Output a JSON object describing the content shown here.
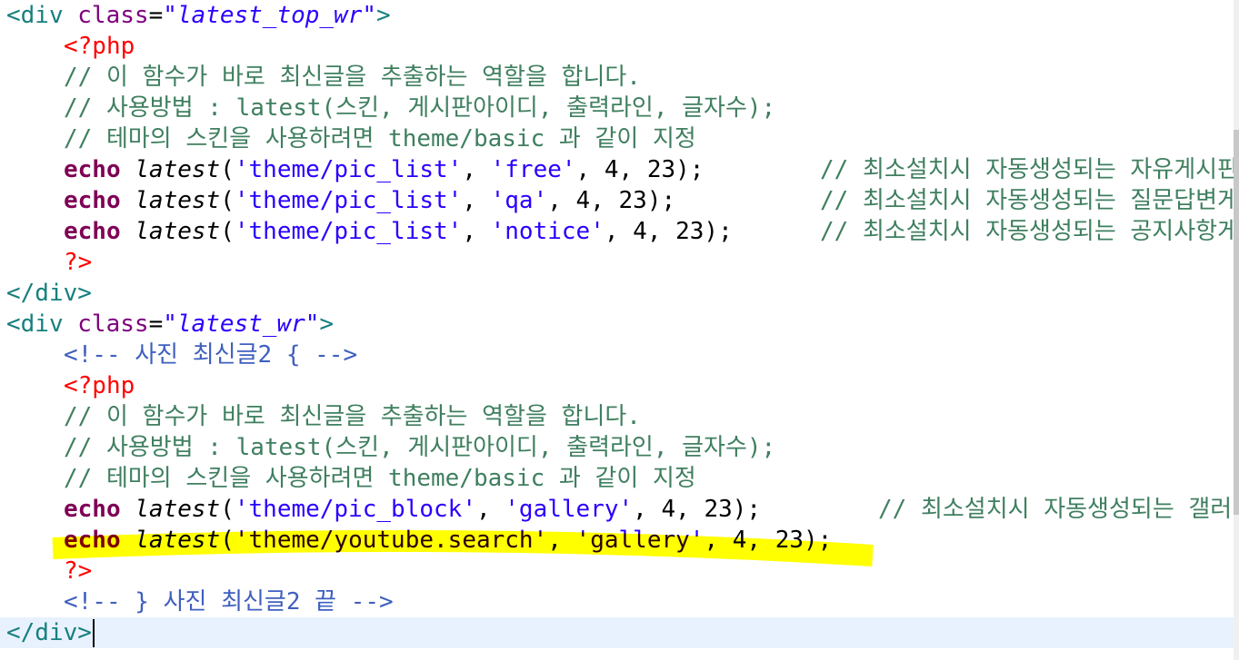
{
  "colors": {
    "highlight": "#ffff00",
    "current_line": "#e8f2fe"
  },
  "lines": [
    {
      "indent": 0,
      "tokens": [
        {
          "k": "tag",
          "t": "<div "
        },
        {
          "k": "attr",
          "t": "class"
        },
        {
          "k": "eq",
          "t": "="
        },
        {
          "k": "val",
          "t": "\"latest_top_wr\""
        },
        {
          "k": "tag",
          "t": ">"
        }
      ]
    },
    {
      "indent": 1,
      "tokens": [
        {
          "k": "php",
          "t": "<?php"
        }
      ]
    },
    {
      "indent": 1,
      "tokens": [
        {
          "k": "cmt",
          "t": "// 이 함수가 바로 최신글을 추출하는 역할을 합니다."
        }
      ]
    },
    {
      "indent": 1,
      "tokens": [
        {
          "k": "cmt",
          "t": "// 사용방법 : latest(스킨, 게시판아이디, 출력라인, 글자수);"
        }
      ]
    },
    {
      "indent": 1,
      "tokens": [
        {
          "k": "cmt",
          "t": "// 테마의 스킨을 사용하려면 theme/basic 과 같이 지정"
        }
      ]
    },
    {
      "indent": 1,
      "tokens": [
        {
          "k": "kw",
          "t": "echo"
        },
        {
          "k": "pun",
          "t": " "
        },
        {
          "k": "fn",
          "t": "latest"
        },
        {
          "k": "pun",
          "t": "("
        },
        {
          "k": "str",
          "t": "'theme/pic_list'"
        },
        {
          "k": "pun",
          "t": ", "
        },
        {
          "k": "str",
          "t": "'free'"
        },
        {
          "k": "pun",
          "t": ", 4, 23);"
        }
      ],
      "tail": {
        "col": "c902",
        "t": "// 최소설치시 자동생성되는 자유게시판"
      }
    },
    {
      "indent": 1,
      "tokens": [
        {
          "k": "kw",
          "t": "echo"
        },
        {
          "k": "pun",
          "t": " "
        },
        {
          "k": "fn",
          "t": "latest"
        },
        {
          "k": "pun",
          "t": "("
        },
        {
          "k": "str",
          "t": "'theme/pic_list'"
        },
        {
          "k": "pun",
          "t": ", "
        },
        {
          "k": "str",
          "t": "'qa'"
        },
        {
          "k": "pun",
          "t": ", 4, 23);"
        }
      ],
      "tail": {
        "col": "c902",
        "t": "// 최소설치시 자동생성되는 질문답변게시"
      }
    },
    {
      "indent": 1,
      "tokens": [
        {
          "k": "kw",
          "t": "echo"
        },
        {
          "k": "pun",
          "t": " "
        },
        {
          "k": "fn",
          "t": "latest"
        },
        {
          "k": "pun",
          "t": "("
        },
        {
          "k": "str",
          "t": "'theme/pic_list'"
        },
        {
          "k": "pun",
          "t": ", "
        },
        {
          "k": "str",
          "t": "'notice'"
        },
        {
          "k": "pun",
          "t": ", 4, 23);"
        }
      ],
      "tail": {
        "col": "c902",
        "t": "// 최소설치시 자동생성되는 공지사항게시"
      }
    },
    {
      "indent": 1,
      "tokens": [
        {
          "k": "php",
          "t": "?>"
        }
      ]
    },
    {
      "indent": 0,
      "tokens": [
        {
          "k": "tag",
          "t": "</div>"
        }
      ]
    },
    {
      "indent": 0,
      "tokens": [
        {
          "k": "tag",
          "t": "<div "
        },
        {
          "k": "attr",
          "t": "class"
        },
        {
          "k": "eq",
          "t": "="
        },
        {
          "k": "val",
          "t": "\"latest_wr\""
        },
        {
          "k": "tag",
          "t": ">"
        }
      ]
    },
    {
      "indent": 1,
      "tokens": [
        {
          "k": "html-cmt",
          "t": "<!-- 사진 최신글2 { -->"
        }
      ]
    },
    {
      "indent": 1,
      "tokens": [
        {
          "k": "php",
          "t": "<?php"
        }
      ]
    },
    {
      "indent": 1,
      "tokens": [
        {
          "k": "cmt",
          "t": "// 이 함수가 바로 최신글을 추출하는 역할을 합니다."
        }
      ]
    },
    {
      "indent": 1,
      "tokens": [
        {
          "k": "cmt",
          "t": "// 사용방법 : latest(스킨, 게시판아이디, 출력라인, 글자수);"
        }
      ]
    },
    {
      "indent": 1,
      "tokens": [
        {
          "k": "cmt",
          "t": "// 테마의 스킨을 사용하려면 theme/basic 과 같이 지정"
        }
      ]
    },
    {
      "indent": 1,
      "tokens": [
        {
          "k": "kw",
          "t": "echo"
        },
        {
          "k": "pun",
          "t": " "
        },
        {
          "k": "fn",
          "t": "latest"
        },
        {
          "k": "pun",
          "t": "("
        },
        {
          "k": "str",
          "t": "'theme/pic_block'"
        },
        {
          "k": "pun",
          "t": ", "
        },
        {
          "k": "str",
          "t": "'gallery'"
        },
        {
          "k": "pun",
          "t": ", 4, 23);"
        }
      ],
      "tail": {
        "col": "c966",
        "t": "// 최소설치시 자동생성되는 갤러리"
      }
    },
    {
      "indent": 1,
      "tokens": [
        {
          "k": "kw",
          "t": "echo"
        },
        {
          "k": "pun",
          "t": " "
        },
        {
          "k": "fn",
          "t": "latest"
        },
        {
          "k": "pun",
          "t": "("
        },
        {
          "k": "str",
          "t": "'theme/youtube.search'"
        },
        {
          "k": "pun",
          "t": ", "
        },
        {
          "k": "str",
          "t": "'gallery'"
        },
        {
          "k": "pun",
          "t": ", 4, 23);"
        }
      ]
    },
    {
      "indent": 1,
      "tokens": [
        {
          "k": "php",
          "t": "?>"
        }
      ]
    },
    {
      "indent": 1,
      "tokens": [
        {
          "k": "html-cmt",
          "t": "<!-- } 사진 최신글2 끝 -->"
        }
      ]
    },
    {
      "indent": 0,
      "current": true,
      "tokens": [
        {
          "k": "tag",
          "t": "</div>"
        }
      ]
    }
  ]
}
